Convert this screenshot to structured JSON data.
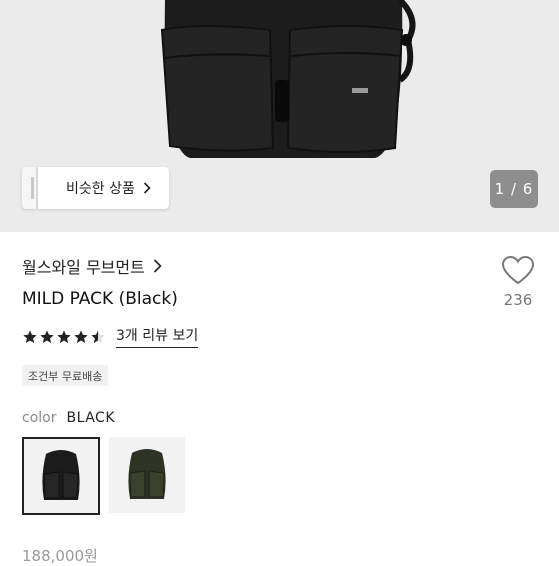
{
  "gallery": {
    "similar_label": "비슷한 상품",
    "pager_label": "1 / 6"
  },
  "product": {
    "brand": "월스와일 무브먼트",
    "title": "MILD PACK (Black)",
    "like_count": "236",
    "rating": 4.5,
    "review_link": "3개 리뷰 보기",
    "shipping_badge": "조건부 무료배송",
    "color_key": "color",
    "color_value": "BLACK",
    "price": "188,000원"
  },
  "icons": {
    "brand_arrow": "chevron-right-icon",
    "similar_arrow": "chevron-right-icon",
    "like": "heart-outline-icon",
    "star": "star-icon"
  },
  "colors": {
    "hero_bg": "#ebebeb",
    "pager_bg": "#8e8e8e",
    "star": "#222222",
    "badge_bg": "#f1f1f1"
  }
}
